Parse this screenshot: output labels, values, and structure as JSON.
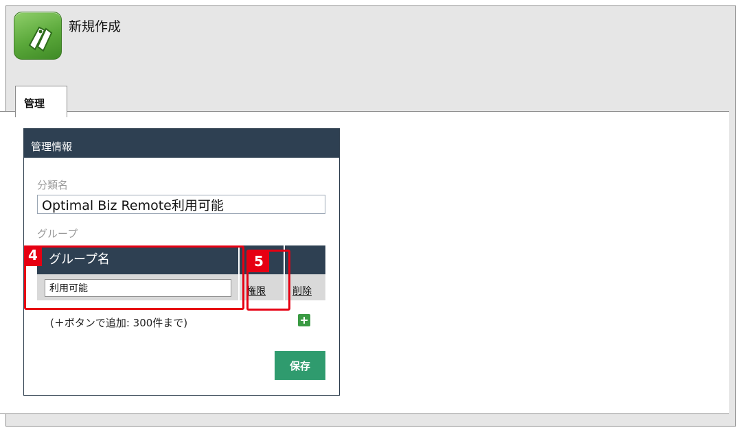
{
  "app": {
    "title": "新規作成"
  },
  "tabs": [
    {
      "label": "管理"
    }
  ],
  "panel": {
    "header": "管理情報",
    "category_label": "分類名",
    "category_value": "Optimal Biz Remote利用可能",
    "group_label": "グループ",
    "table": {
      "col_group_name": "グループ名",
      "row": {
        "group_value": "利用可能",
        "permission_link": "権限",
        "delete_link": "削除"
      }
    },
    "hint": "(＋ボタンで追加: 300件まで)",
    "save_label": "保存"
  },
  "annotations": [
    {
      "number": "4"
    },
    {
      "number": "5"
    }
  ],
  "colors": {
    "header_bg": "#2e4052",
    "save_button": "#2f9b6e",
    "add_button": "#3a9a43",
    "callout": "#e60012",
    "app_icon": "#5aa83a"
  },
  "icons": {
    "app": "tag-icon",
    "add": "plus-icon"
  }
}
